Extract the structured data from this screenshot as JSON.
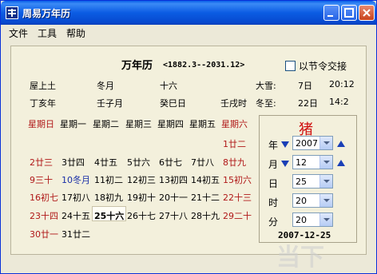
{
  "window": {
    "title": "周易万年历"
  },
  "menu": [
    "文件",
    "工具",
    "帮助"
  ],
  "header": {
    "title": "万年历",
    "range": "<1882.3--2031.12>",
    "jieqi_checkbox_label": "以节令交接"
  },
  "info": {
    "row1": [
      "屋上土",
      "冬月",
      "十六",
      "大雪:",
      "7日",
      "20:12"
    ],
    "row2": [
      "丁亥年",
      "壬子月",
      "癸巳日",
      "壬戌时",
      "冬至:",
      "22日",
      "14:2"
    ]
  },
  "weekdays": [
    "星期日",
    "星期一",
    "星期二",
    "星期三",
    "星期四",
    "星期五",
    "星期六"
  ],
  "calendar": [
    [
      "",
      "",
      "",
      "",
      "",
      "",
      "1廿二"
    ],
    [
      "2廿三",
      "3廿四",
      "4廿五",
      "5廿六",
      "6廿七",
      "7廿八",
      "8廿九"
    ],
    [
      "9三十",
      "10冬月",
      "11初二",
      "12初三",
      "13初四",
      "14初五",
      "15初六"
    ],
    [
      "16初七",
      "17初八",
      "18初九",
      "19初十",
      "20十一",
      "21十二",
      "22十三"
    ],
    [
      "23十四",
      "24十五",
      "25十六",
      "26十七",
      "27十八",
      "28十九",
      "29二十"
    ],
    [
      "30廿一",
      "31廿二",
      "",
      "",
      "",
      "",
      ""
    ]
  ],
  "side": {
    "zodiac": "猪",
    "year_label": "年",
    "year_value": "2007",
    "month_label": "月",
    "month_value": "12",
    "day_label": "日",
    "day_value": "25",
    "hour_label": "时",
    "hour_value": "20",
    "minute_label": "分",
    "minute_value": "20",
    "date_output": "2007-12-25"
  },
  "colors": {
    "weekend": "#b01818",
    "normal": "#000000",
    "highlight": "#1a2fa8"
  },
  "watermark": "当下软件园"
}
